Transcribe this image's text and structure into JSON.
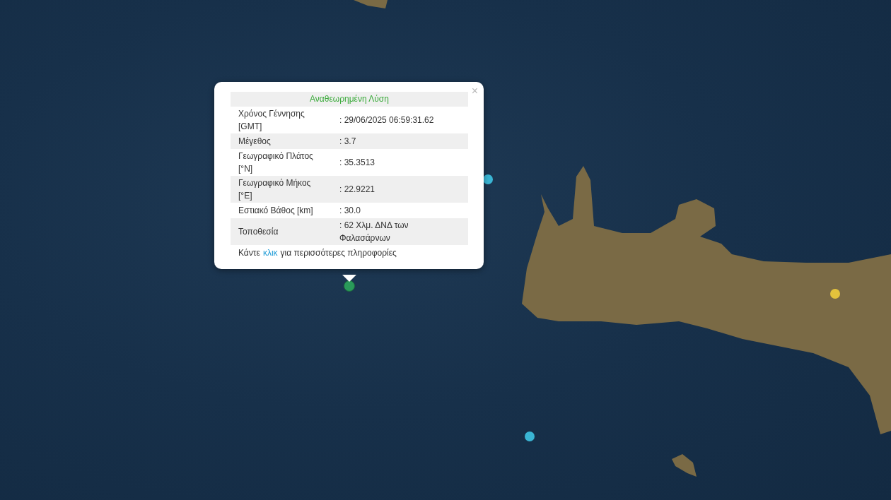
{
  "markers": [
    {
      "color": "#2a9a5a",
      "selected": true
    },
    {
      "color": "#3ab5d4",
      "selected": false
    },
    {
      "color": "#3ab5d4",
      "selected": false
    },
    {
      "color": "#e3c23c",
      "selected": false
    }
  ],
  "popup": {
    "title": "Αναθεωρημένη Λύση",
    "close": "×",
    "rows": [
      {
        "label": "Χρόνος Γέννησης [GMT]",
        "value": ": 29/06/2025 06:59:31.62"
      },
      {
        "label": "Μέγεθος",
        "value": ": 3.7"
      },
      {
        "label": "Γεωγραφικό Πλάτος [°N]",
        "value": ": 35.3513"
      },
      {
        "label": "Γεωγραφικό Μήκος [°E]",
        "value": ": 22.9221"
      },
      {
        "label": "Εστιακό Βάθος [km]",
        "value": ": 30.0"
      },
      {
        "label": "Τοποθεσία",
        "value": ": 62 Χλμ. ΔΝΔ των Φαλασάρνων"
      }
    ],
    "footer": {
      "before": "Κάντε",
      "link": "κλικ",
      "after": "για περισσότερες πληροφορίες"
    }
  }
}
